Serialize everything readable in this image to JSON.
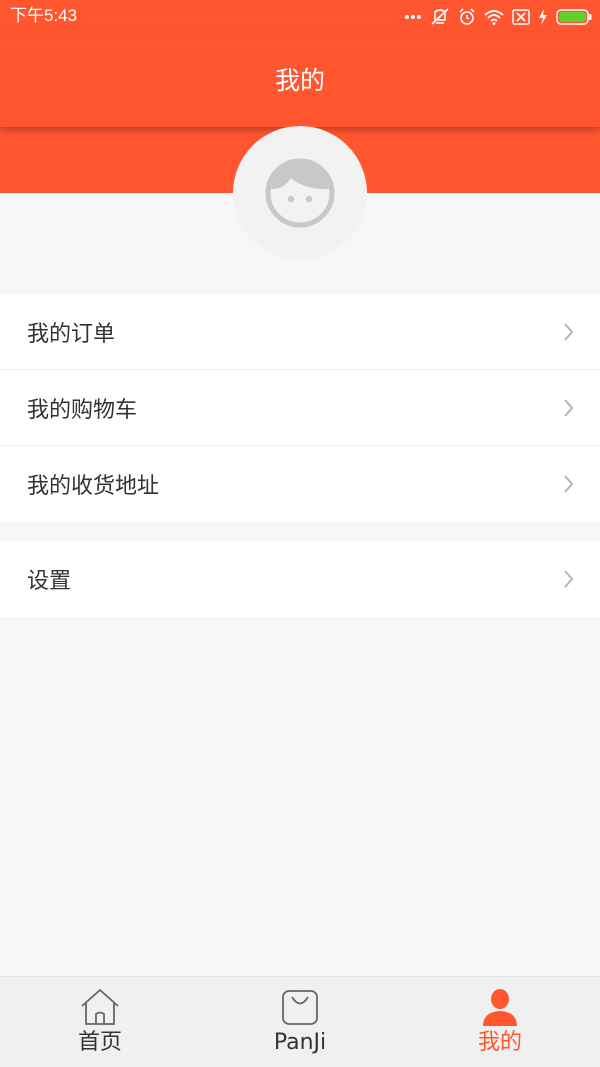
{
  "status_bar": {
    "time": "下午5:43",
    "icons": [
      "more-dots-icon",
      "vibrate-off-icon",
      "alarm-icon",
      "wifi-icon",
      "sim-off-icon",
      "charging-icon",
      "battery-icon"
    ]
  },
  "header": {
    "title": "我的",
    "accent_color": "#ff5630"
  },
  "profile": {
    "avatar_icon": "user-face-icon"
  },
  "menu": {
    "group1": [
      {
        "label": "我的订单"
      },
      {
        "label": "我的购物车"
      },
      {
        "label": "我的收货地址"
      }
    ],
    "group2": [
      {
        "label": "设置"
      }
    ]
  },
  "tabbar": {
    "tabs": [
      {
        "label": "首页",
        "icon": "home-icon",
        "active": false
      },
      {
        "label": "PanJi",
        "icon": "shopping-bag-icon",
        "active": false
      },
      {
        "label": "我的",
        "icon": "person-icon",
        "active": true
      }
    ],
    "active_color": "#ff5630"
  }
}
